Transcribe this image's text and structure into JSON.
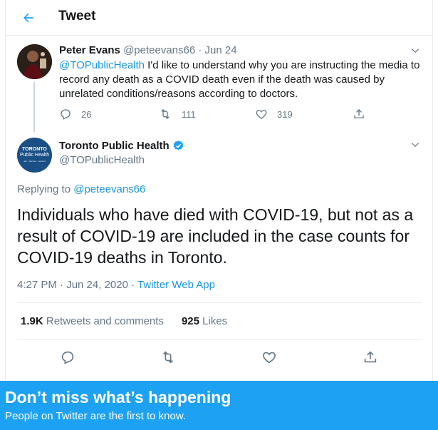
{
  "header": {
    "title": "Tweet"
  },
  "parent_tweet": {
    "author_name": "Peter Evans",
    "handle": "@peteevans66",
    "separator": "·",
    "date": "Jun 24",
    "mention": "@TOPublicHealth",
    "text": " I'd like to understand why you are instructing the media to record any death as a COVID death even if the death was caused by unrelated conditions/reasons according to doctors.",
    "replies": "26",
    "retweets": "111",
    "likes": "319"
  },
  "main_tweet": {
    "author_name": "Toronto Public Health",
    "handle": "@TOPublicHealth",
    "avatar": {
      "line1": "TORONTO",
      "line2": "Public Health",
      "line3": "ask · discuss · connect"
    },
    "replying_prefix": "Replying to ",
    "replying_to": "@peteevans66",
    "text": "Individuals who have died with COVID-19, but not as a result of COVID-19 are included in the case counts for COVID-19 deaths in Toronto.",
    "time": "4:27 PM · Jun 24, 2020 · ",
    "source": "Twitter Web App",
    "retweets_count": "1.9K",
    "retweets_label": "Retweets and comments",
    "likes_count": "925",
    "likes_label": "Likes"
  },
  "banner": {
    "title": "Don’t miss what’s happening",
    "subtitle": "People on Twitter are the first to know."
  },
  "colors": {
    "accent": "#1da1f2",
    "link": "#1b95e0",
    "muted": "#657786",
    "text": "#14171a",
    "border": "#e6ecf0"
  }
}
